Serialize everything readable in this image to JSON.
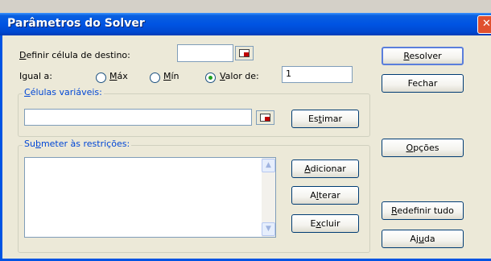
{
  "window": {
    "title": "Parâmetros do Solver",
    "close_symbol": "✕"
  },
  "target_cell": {
    "label_u": "D",
    "label_rest": "efinir célula de destino:",
    "value": ""
  },
  "equal_to": {
    "label": "Igual a:",
    "options": [
      {
        "pre": "",
        "u": "M",
        "post": "áx",
        "checked": false
      },
      {
        "pre": "",
        "u": "M",
        "post": "ín",
        "checked": false
      },
      {
        "pre": "",
        "u": "V",
        "post": "alor de:",
        "checked": true
      }
    ],
    "value_of": "1"
  },
  "variable_cells": {
    "legend_u": "C",
    "legend_rest": "élulas variáveis:",
    "value": ""
  },
  "constraints": {
    "legend_pre": "Su",
    "legend_u": "b",
    "legend_post": "meter às restrições:",
    "items": []
  },
  "buttons": {
    "resolver": {
      "pre": "",
      "u": "R",
      "post": "esolver"
    },
    "fechar": {
      "pre": "",
      "u": "",
      "post": "Fechar"
    },
    "estimar": {
      "pre": "Es",
      "u": "t",
      "post": "imar"
    },
    "opcoes": {
      "pre": "",
      "u": "O",
      "post": "pções"
    },
    "adicionar": {
      "pre": "",
      "u": "A",
      "post": "dicionar"
    },
    "alterar": {
      "pre": "A",
      "u": "l",
      "post": "terar"
    },
    "excluir": {
      "pre": "E",
      "u": "x",
      "post": "cluir"
    },
    "redefinir": {
      "pre": "",
      "u": "R",
      "post": "edefinir tudo"
    },
    "ajuda": {
      "pre": "Aj",
      "u": "u",
      "post": "da"
    }
  }
}
